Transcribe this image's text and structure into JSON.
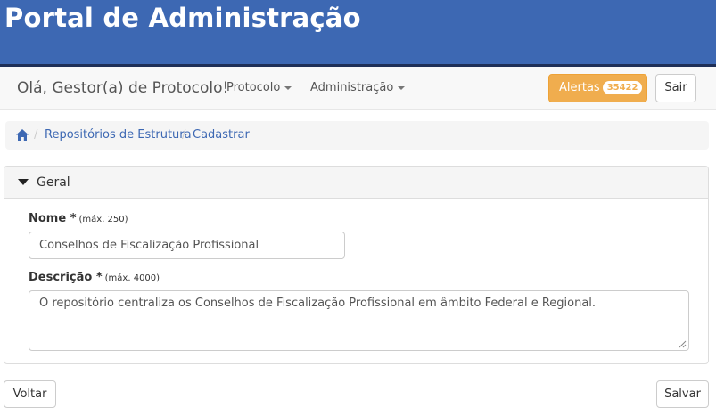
{
  "header": {
    "title": "Portal de Administração"
  },
  "navbar": {
    "greeting": "Olá, Gestor(a) de Protocolo!",
    "menus": [
      "Protocolo",
      "Administração"
    ],
    "alerts_label": "Alertas",
    "alerts_count": "35422",
    "logout_label": "Sair",
    "alert_color": "#f0ad4e"
  },
  "breadcrumb": {
    "home_icon": "home-icon",
    "items": [
      "Repositórios de Estrutura",
      "Cadastrar"
    ]
  },
  "panel": {
    "heading": "Geral",
    "name_field": {
      "label": "Nome *",
      "hint": "(máx. 250)",
      "value": "Conselhos de Fiscalização Profissional"
    },
    "description_field": {
      "label": "Descrição *",
      "hint": "(máx. 4000)",
      "value": "O repositório centraliza os Conselhos de Fiscalização Profissional em âmbito Federal e Regional."
    }
  },
  "actions": {
    "back_label": "Voltar",
    "save_label": "Salvar"
  },
  "colors": {
    "header_bg": "#3d68b3",
    "link": "#3d68b3"
  }
}
